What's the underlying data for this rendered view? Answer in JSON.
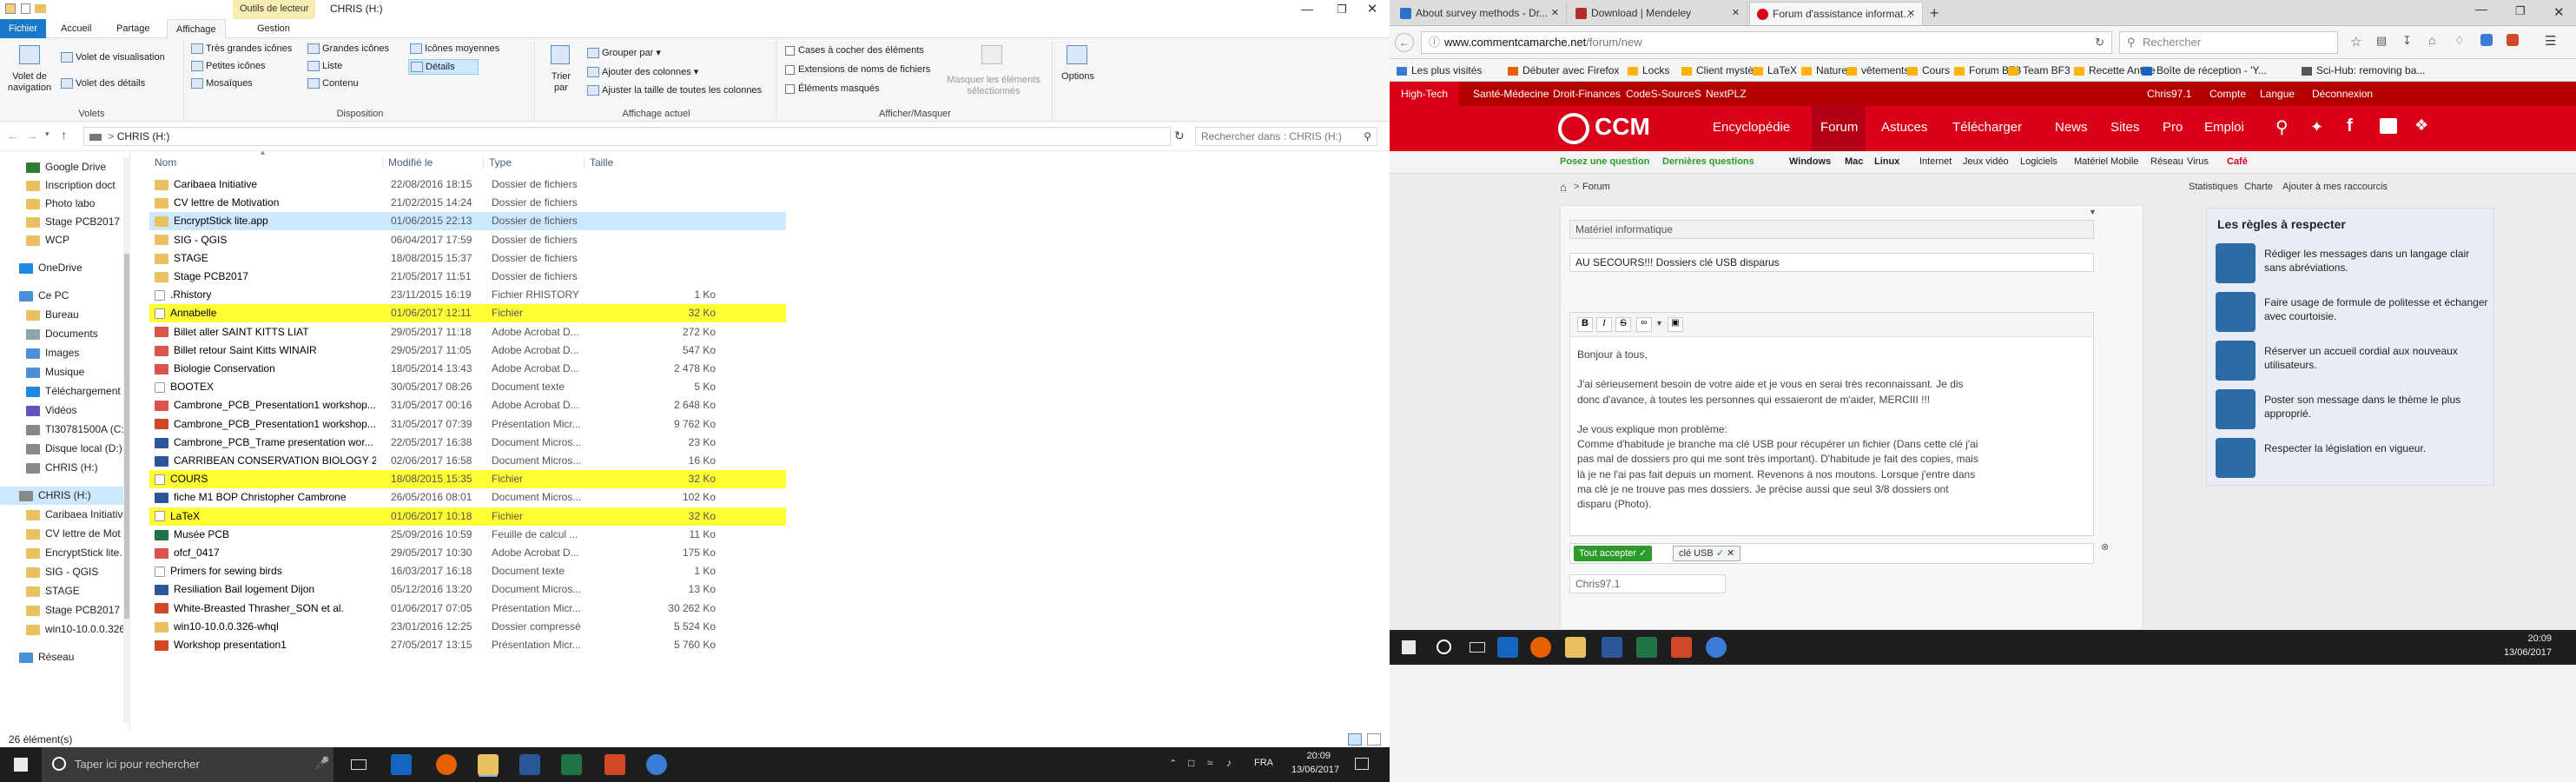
{
  "explorer": {
    "title_tool_tab": "Outils de lecteur",
    "window_title": "CHRIS (H:)",
    "tabs": [
      "Fichier",
      "Accueil",
      "Partage",
      "Affichage",
      "Gestion"
    ],
    "ribbon": {
      "panes_group_label": "Volets",
      "nav_pane": "Volet de navigation",
      "preview_pane": "Volet de visualisation",
      "details_pane": "Volet des détails",
      "layout_group_label": "Disposition",
      "layout_items": [
        "Très grandes icônes",
        "Grandes icônes",
        "Icônes moyennes",
        "Petites icônes",
        "Liste",
        "Détails",
        "Mosaïques",
        "Contenu"
      ],
      "current_view_label": "Affichage actuel",
      "sort_by": "Trier par",
      "group_by": "Grouper par",
      "add_columns": "Ajouter des colonnes",
      "fit_columns": "Ajuster la taille de toutes les colonnes",
      "show_hide_label": "Afficher/Masquer",
      "item_checkboxes": "Cases à cocher des éléments",
      "file_extensions": "Extensions de noms de fichiers",
      "hidden_items": "Éléments masqués",
      "hide_selected": "Masquer les éléments sélectionnés",
      "options": "Options"
    },
    "address": "CHRIS (H:)",
    "search_placeholder": "Rechercher dans : CHRIS (H:)",
    "nav_items": [
      "Google Drive",
      "Inscription doct",
      "Photo labo",
      "Stage PCB2017",
      "WCP",
      "OneDrive",
      "Ce PC",
      "Bureau",
      "Documents",
      "Images",
      "Musique",
      "Téléchargement",
      "Vidéos",
      "TI30781500A (C:)",
      "Disque local (D:)",
      "CHRIS (H:)",
      "CHRIS (H:)",
      "Caribaea Initiativ",
      "CV lettre de Mot",
      "EncryptStick lite.",
      "SIG - QGIS",
      "STAGE",
      "Stage PCB2017",
      "win10-10.0.0.326",
      "Réseau"
    ],
    "columns": {
      "name": "Nom",
      "date": "Modifié le",
      "type": "Type",
      "size": "Taille"
    },
    "files": [
      {
        "name": "Caribaea Initiative",
        "date": "22/08/2016 18:15",
        "type": "Dossier de fichiers",
        "size": "",
        "icon": "folder",
        "state": ""
      },
      {
        "name": "CV lettre de Motivation",
        "date": "21/02/2015 14:24",
        "type": "Dossier de fichiers",
        "size": "",
        "icon": "folder",
        "state": ""
      },
      {
        "name": "EncryptStick lite.app",
        "date": "01/06/2015 22:13",
        "type": "Dossier de fichiers",
        "size": "",
        "icon": "folder",
        "state": "sel"
      },
      {
        "name": "SIG - QGIS",
        "date": "06/04/2017 17:59",
        "type": "Dossier de fichiers",
        "size": "",
        "icon": "folder",
        "state": ""
      },
      {
        "name": "STAGE",
        "date": "18/08/2015 15:37",
        "type": "Dossier de fichiers",
        "size": "",
        "icon": "folder",
        "state": ""
      },
      {
        "name": "Stage PCB2017",
        "date": "21/05/2017 11:51",
        "type": "Dossier de fichiers",
        "size": "",
        "icon": "folder",
        "state": ""
      },
      {
        "name": ".Rhistory",
        "date": "23/11/2015 16:19",
        "type": "Fichier RHISTORY",
        "size": "1 Ko",
        "icon": "blank",
        "state": ""
      },
      {
        "name": "Annabelle",
        "date": "01/06/2017 12:11",
        "type": "Fichier",
        "size": "32 Ko",
        "icon": "blank",
        "state": "hl"
      },
      {
        "name": "Billet aller SAINT KITTS LIAT",
        "date": "29/05/2017 11:18",
        "type": "Adobe Acrobat D...",
        "size": "272 Ko",
        "icon": "pdf",
        "state": ""
      },
      {
        "name": "Billet retour Saint Kitts WINAIR",
        "date": "29/05/2017 11:05",
        "type": "Adobe Acrobat D...",
        "size": "547 Ko",
        "icon": "pdf",
        "state": ""
      },
      {
        "name": "Biologie Conservation",
        "date": "18/05/2014 13:43",
        "type": "Adobe Acrobat D...",
        "size": "2 478 Ko",
        "icon": "pdf",
        "state": ""
      },
      {
        "name": "BOOTEX",
        "date": "30/05/2017 08:26",
        "type": "Document texte",
        "size": "5 Ko",
        "icon": "txt",
        "state": ""
      },
      {
        "name": "Cambrone_PCB_Presentation1 workshop...",
        "date": "31/05/2017 00:16",
        "type": "Adobe Acrobat D...",
        "size": "2 648 Ko",
        "icon": "pdf",
        "state": ""
      },
      {
        "name": "Cambrone_PCB_Presentation1 workshop...",
        "date": "31/05/2017 07:39",
        "type": "Présentation Micr...",
        "size": "9 762 Ko",
        "icon": "ppt",
        "state": ""
      },
      {
        "name": "Cambrone_PCB_Trame presentation wor...",
        "date": "22/05/2017 16:38",
        "type": "Document Micros...",
        "size": "23 Ko",
        "icon": "doc",
        "state": ""
      },
      {
        "name": "CARRIBEAN CONSERVATION BIOLOGY 2...",
        "date": "02/06/2017 16:58",
        "type": "Document Micros...",
        "size": "16 Ko",
        "icon": "doc",
        "state": ""
      },
      {
        "name": "COURS",
        "date": "18/08/2015 15:35",
        "type": "Fichier",
        "size": "32 Ko",
        "icon": "blank",
        "state": "hl"
      },
      {
        "name": "fiche M1 BOP Christopher Cambrone",
        "date": "26/05/2016 08:01",
        "type": "Document Micros...",
        "size": "102 Ko",
        "icon": "doc",
        "state": ""
      },
      {
        "name": "LaTeX",
        "date": "01/06/2017 10:18",
        "type": "Fichier",
        "size": "32 Ko",
        "icon": "blank",
        "state": "hl"
      },
      {
        "name": "Musée PCB",
        "date": "25/09/2016 10:59",
        "type": "Feuille de calcul ...",
        "size": "11 Ko",
        "icon": "xls",
        "state": ""
      },
      {
        "name": "ofcf_0417",
        "date": "29/05/2017 10:30",
        "type": "Adobe Acrobat D...",
        "size": "175 Ko",
        "icon": "pdf",
        "state": ""
      },
      {
        "name": "Primers for sewing birds",
        "date": "16/03/2017 16:18",
        "type": "Document texte",
        "size": "1 Ko",
        "icon": "txt",
        "state": ""
      },
      {
        "name": "Resiliation Bail logement Dijon",
        "date": "05/12/2016 13:20",
        "type": "Document Micros...",
        "size": "13 Ko",
        "icon": "doc",
        "state": ""
      },
      {
        "name": "White-Breasted Thrasher_SON et al.",
        "date": "01/06/2017 07:05",
        "type": "Présentation Micr...",
        "size": "30 262 Ko",
        "icon": "ppt",
        "state": ""
      },
      {
        "name": "win10-10.0.0.326-whql",
        "date": "23/01/2016 12:25",
        "type": "Dossier compressé",
        "size": "5 524 Ko",
        "icon": "zip",
        "state": ""
      },
      {
        "name": "Workshop presentation1",
        "date": "27/05/2017 13:15",
        "type": "Présentation Micr...",
        "size": "5 760 Ko",
        "icon": "ppt",
        "state": ""
      }
    ],
    "status": "26 élément(s)"
  },
  "taskbar_left": {
    "search_placeholder": "Taper ici pour rechercher",
    "time": "20:09",
    "date": "13/06/2017",
    "lang": "FRA"
  },
  "browser": {
    "tabs": [
      "About survey methods - Dr...",
      "Download | Mendeley",
      "Forum d'assistance informat..."
    ],
    "url_host": "www.commentcamarche.net",
    "url_path": "/forum/new",
    "search_placeholder": "Rechercher",
    "bookmarks": [
      "Les plus visités",
      "Débuter avec Firefox",
      "Locks",
      "Client mystère",
      "LaTeX",
      "Nature",
      "vêtements",
      "Cours",
      "Forum BF3",
      "Team BF3",
      "Recette Antille",
      "Boîte de réception - 'Y...",
      "Sci-Hub: removing ba..."
    ],
    "site": {
      "top_links": [
        "High-Tech",
        "Santé-Médecine",
        "Droit-Finances",
        "CodeS-SourceS",
        "NextPLZ"
      ],
      "user_links": [
        "Chris97.1",
        "Compte",
        "Langue",
        "Déconnexion"
      ],
      "logo": "CCM",
      "nav": [
        "Encyclopédie",
        "Forum",
        "Astuces",
        "Télécharger",
        "News",
        "Sites",
        "Pro",
        "Emploi"
      ],
      "sub_nav_left": [
        "Posez une question",
        "Dernières questions"
      ],
      "sub_nav": [
        "Windows",
        "Mac",
        "Linux",
        "Internet",
        "Jeux vidéo",
        "Logiciels",
        "Matériel",
        "Mobile",
        "Réseau",
        "Virus",
        "Café"
      ],
      "breadcrumb": "Forum",
      "crumb_right": [
        "Statistiques",
        "Charte",
        "Ajouter à mes raccourcis"
      ],
      "category": "Matériel informatique",
      "subject": "AU SECOURS!!! Dossiers clé USB disparus",
      "body": [
        "Bonjour à tous,",
        "",
        "J'ai sérieusement besoin de votre aide et je vous en serai très reconnaissant. Je dis",
        "donc d'avance, à toutes les personnes qui essaieront de m'aider, MERCIII !!!",
        "",
        "Je vous explique mon problème:",
        "Comme d'habitude je branche ma clé USB pour récupérer un fichier (Dans cette clé j'ai",
        "pas mal de dossiers pro qui me sont très important). D'habitude je fait des copies, mais",
        "là je ne l'ai pas fait depuis un moment. Revenons à nos moutons. Lorsque j'entre dans",
        "ma clé je ne trouve pas mes dossiers. Je précise aussi que seul 3/8 dossiers ont",
        "disparu (Photo)."
      ],
      "accept_all": "Tout accepter",
      "tag": "clé USB",
      "author": "Chris97.1",
      "rules_title": "Les règles à respecter",
      "rules": [
        "Rédiger les messages dans un langage clair sans abréviations.",
        "Faire usage de formule de politesse et échanger avec courtoisie.",
        "Réserver un accueil cordial aux nouveaux utilisateurs.",
        "Poster son message dans le thème le plus approprié.",
        "Respecter la législation en vigueur."
      ]
    }
  },
  "taskbar_right": {
    "time": "20:09",
    "date": "13/06/2017"
  },
  "colors": {
    "ccm_red": "#d9001a",
    "highlight": "#ffff33",
    "selection": "#cce8ff",
    "taskbar": "#1e1e1e"
  }
}
